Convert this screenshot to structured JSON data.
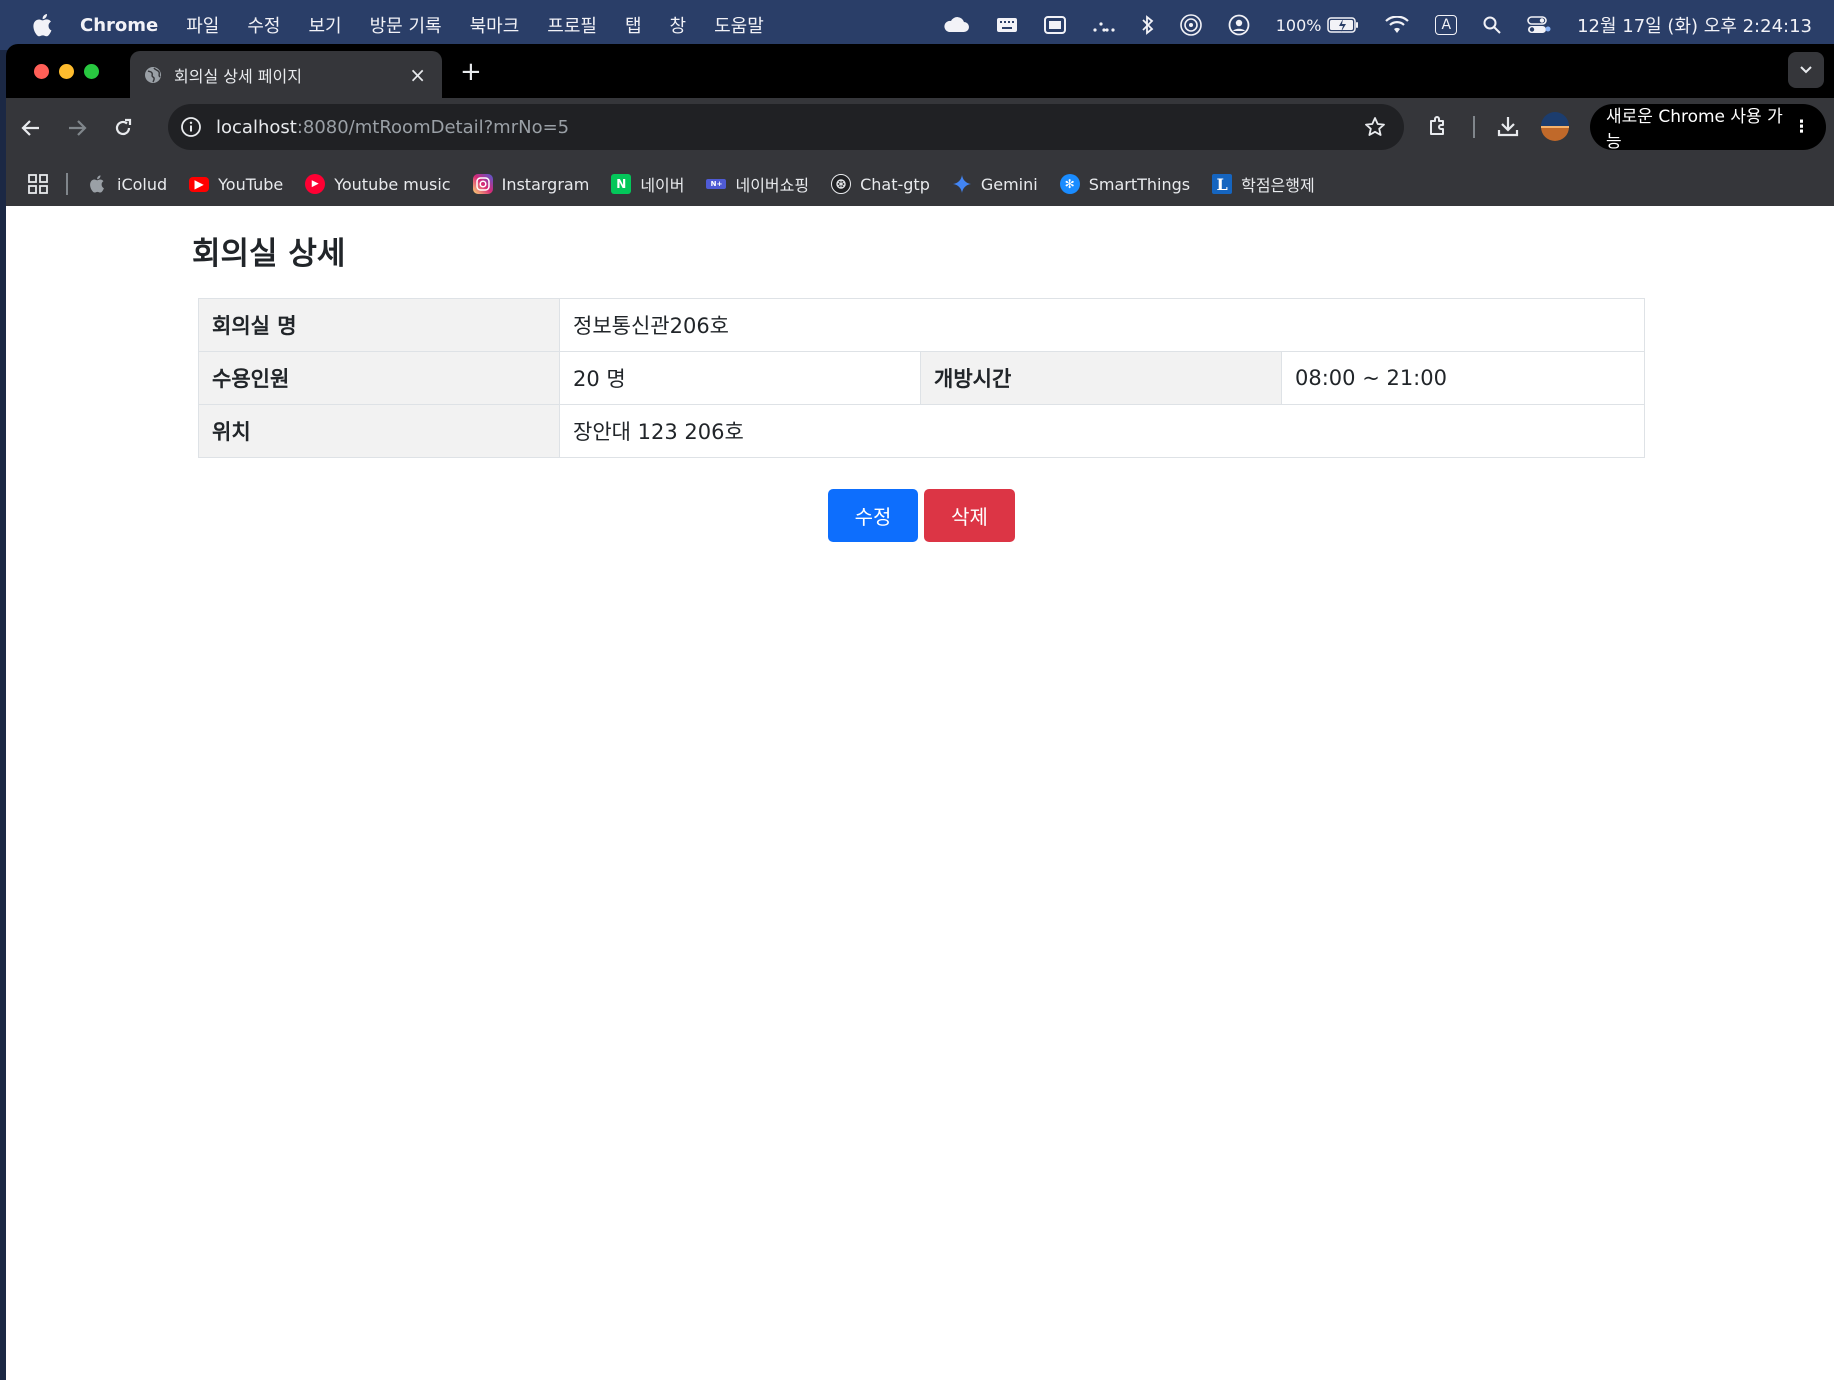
{
  "menubar": {
    "app": "Chrome",
    "items": [
      "파일",
      "수정",
      "보기",
      "방문 기록",
      "북마크",
      "프로필",
      "탭",
      "창",
      "도움말"
    ],
    "battery": "100%",
    "input_source": "A",
    "clock": "12월 17일 (화) 오후 2:24:13"
  },
  "tab": {
    "title": "회의실 상세 페이지",
    "close": "×",
    "new": "+"
  },
  "omnibox": {
    "host": "localhost",
    "rest": ":8080/mtRoomDetail?mrNo=5"
  },
  "update_button": {
    "label": "새로운 Chrome 사용 가능",
    "menu": "⋮"
  },
  "bookmarks": [
    {
      "label": "iColud",
      "icon": "apple-icon",
      "color": "#9aa0a6"
    },
    {
      "label": "YouTube",
      "icon": "youtube-icon",
      "color": "#ff0000"
    },
    {
      "label": "Youtube music",
      "icon": "youtube-music-icon",
      "color": "#ff0033"
    },
    {
      "label": "Instargram",
      "icon": "instagram-icon",
      "color": "#d62976"
    },
    {
      "label": "네이버",
      "icon": "naver-icon",
      "color": "#03c75a"
    },
    {
      "label": "네이버쇼핑",
      "icon": "naver-shopping-icon",
      "color": "#4f5bd5"
    },
    {
      "label": "Chat-gtp",
      "icon": "chatgpt-icon",
      "color": "#202124"
    },
    {
      "label": "Gemini",
      "icon": "gemini-icon",
      "color": "#4285f4"
    },
    {
      "label": "SmartThings",
      "icon": "smartthings-icon",
      "color": "#1a8cff"
    },
    {
      "label": "학점은행제",
      "icon": "l-icon",
      "color": "#1565c0"
    }
  ],
  "page": {
    "title": "회의실 상세",
    "room_name_label": "회의실 명",
    "room_name": "정보통신관206호",
    "capacity_label": "수용인원",
    "capacity": "20 명",
    "hours_label": "개방시간",
    "hours": "08:00 ~ 21:00",
    "location_label": "위치",
    "location": "장안대 123 206호",
    "edit_label": "수정",
    "delete_label": "삭제"
  },
  "colors": {
    "primary": "#0d6efd",
    "danger": "#dc3545",
    "header_cell": "#f2f2f2"
  }
}
